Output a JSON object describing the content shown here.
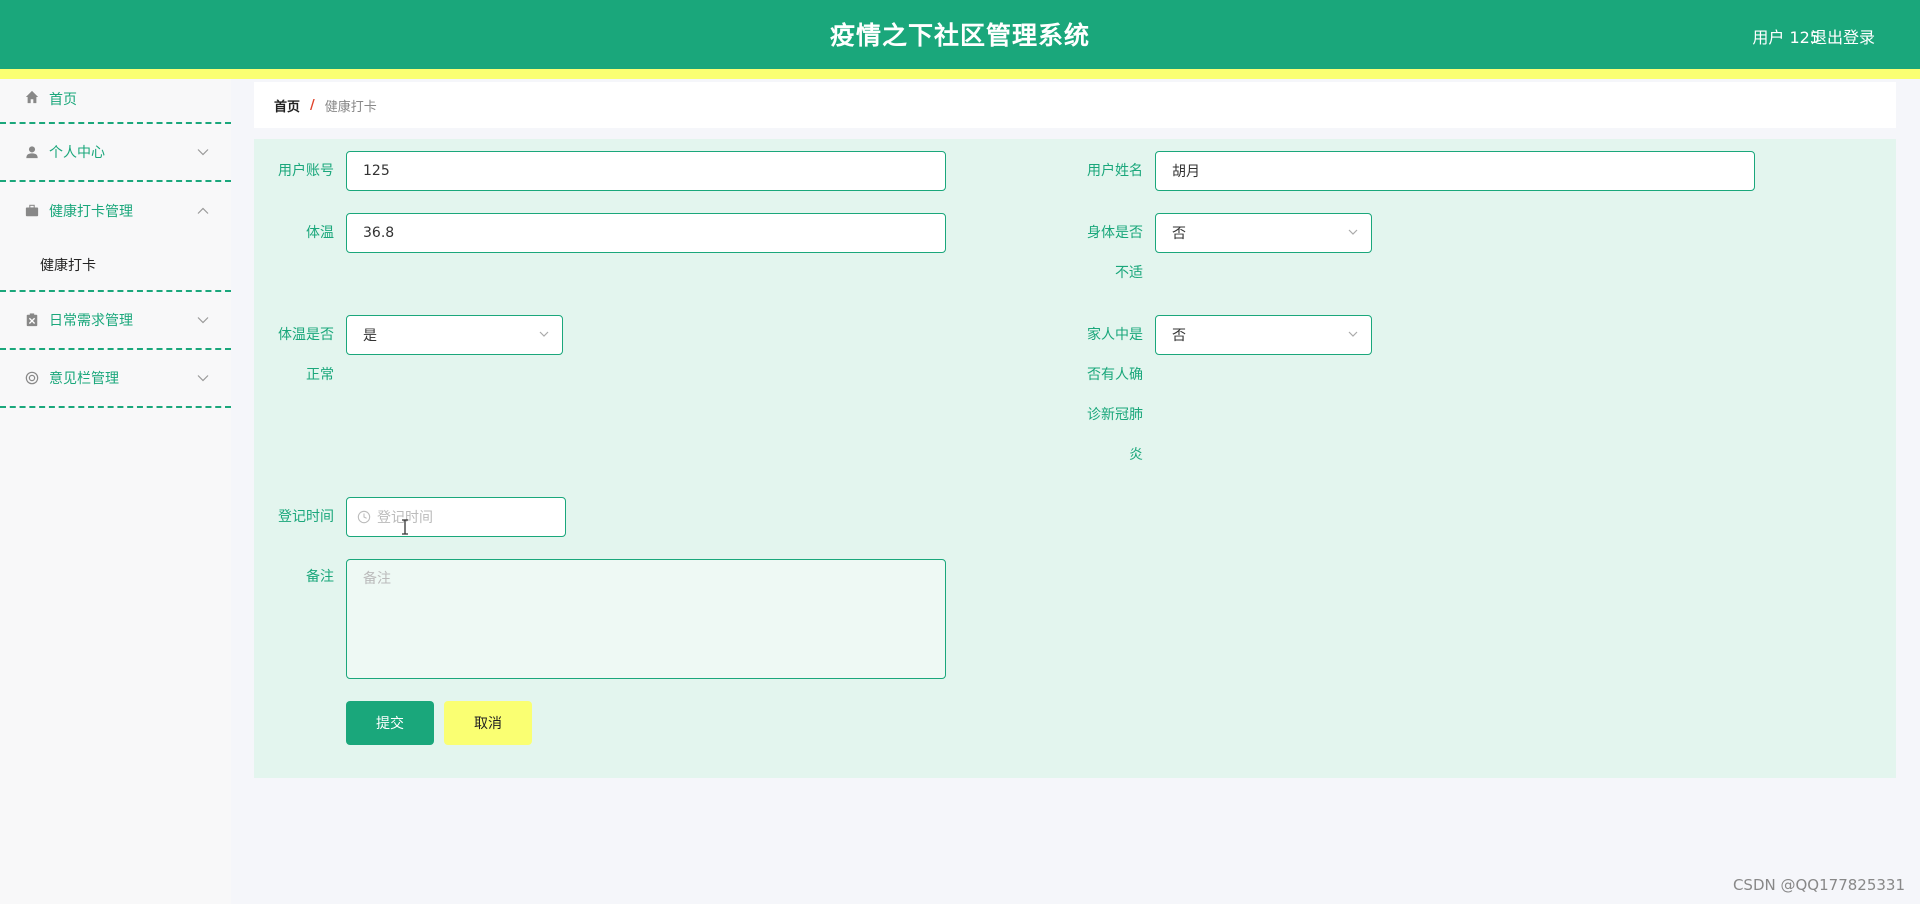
{
  "header": {
    "title": "疫情之下社区管理系统",
    "user": "用户 125",
    "logout": "退出登录"
  },
  "sidebar": {
    "home": "首页",
    "personal": "个人中心",
    "health": "健康打卡管理",
    "health_sub": "健康打卡",
    "daily": "日常需求管理",
    "feedback": "意见栏管理"
  },
  "breadcrumb": {
    "home": "首页",
    "sep": "/",
    "current": "健康打卡"
  },
  "form": {
    "account_label": "用户账号",
    "account_value": "125",
    "name_label": "用户姓名",
    "name_value": "胡月",
    "temp_label": "体温",
    "temp_value": "36.8",
    "unwell_label_1": "身体是否",
    "unwell_label_2": "不适",
    "unwell_value": "否",
    "temp_normal_label_1": "体温是否",
    "temp_normal_label_2": "正常",
    "temp_normal_value": "是",
    "family_label_1": "家人中是",
    "family_label_2": "否有人确",
    "family_label_3": "诊新冠肺",
    "family_label_4": "炎",
    "family_value": "否",
    "time_label": "登记时间",
    "time_placeholder": "登记时间",
    "note_label": "备注",
    "note_placeholder": "备注",
    "submit": "提交",
    "cancel": "取消"
  },
  "watermark": "CSDN @QQ177825331",
  "colors": {
    "primary": "#1aa77b",
    "accent_yellow": "#faff72",
    "panel_bg": "#e3f5ee"
  }
}
